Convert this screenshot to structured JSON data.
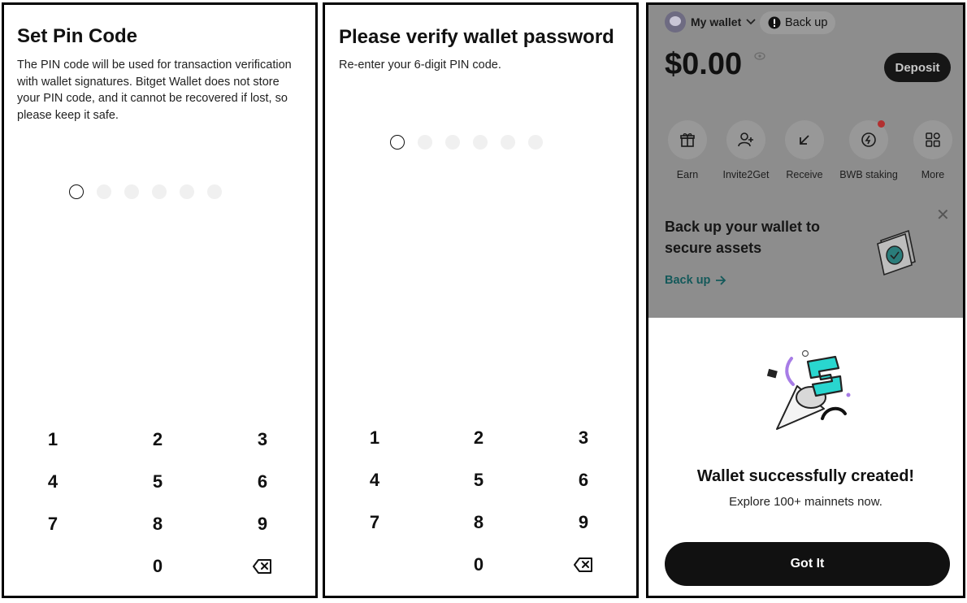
{
  "set_pin": {
    "title": "Set Pin Code",
    "desc_lines": [
      "The PIN code will be used for transaction verification",
      "with wallet signatures. Bitget Wallet does not store",
      "your PIN code, and it cannot be recovered if lost, so",
      "please keep it safe."
    ],
    "pin_filled": 0,
    "pin_length": 6
  },
  "verify": {
    "title": "Please verify wallet password",
    "desc": "Re-enter your 6-digit PIN code."
  },
  "keypad": {
    "keys": [
      "1",
      "2",
      "3",
      "4",
      "5",
      "6",
      "7",
      "8",
      "9",
      "0"
    ],
    "backspace_icon": "backspace-icon"
  },
  "wallet_home": {
    "wallet_name": "My wallet",
    "backup_chip": "Back up",
    "balance": "$0.00",
    "deposit_label": "Deposit",
    "actions": [
      {
        "label": "Earn",
        "icon": "gift-icon"
      },
      {
        "label": "Invite2Get",
        "icon": "add-user-icon"
      },
      {
        "label": "Receive",
        "icon": "arrow-down-left-icon"
      },
      {
        "label": "BWB staking",
        "icon": "staking-icon",
        "badge": true
      },
      {
        "label": "More",
        "icon": "grid-icon"
      }
    ],
    "banner": {
      "title_line1": "Back up your wallet to",
      "title_line2": "secure assets",
      "link": "Back up"
    },
    "sheet": {
      "title": "Wallet successfully created!",
      "subtitle": "Explore 100+ mainnets now.",
      "button": "Got It"
    }
  },
  "colors": {
    "accent": "#111111",
    "link_teal": "#14595a",
    "overlay": "#8d8d8d",
    "badge_red": "#b23030",
    "illustration_teal": "#29d6cf",
    "illustration_purple": "#a77ce6"
  }
}
